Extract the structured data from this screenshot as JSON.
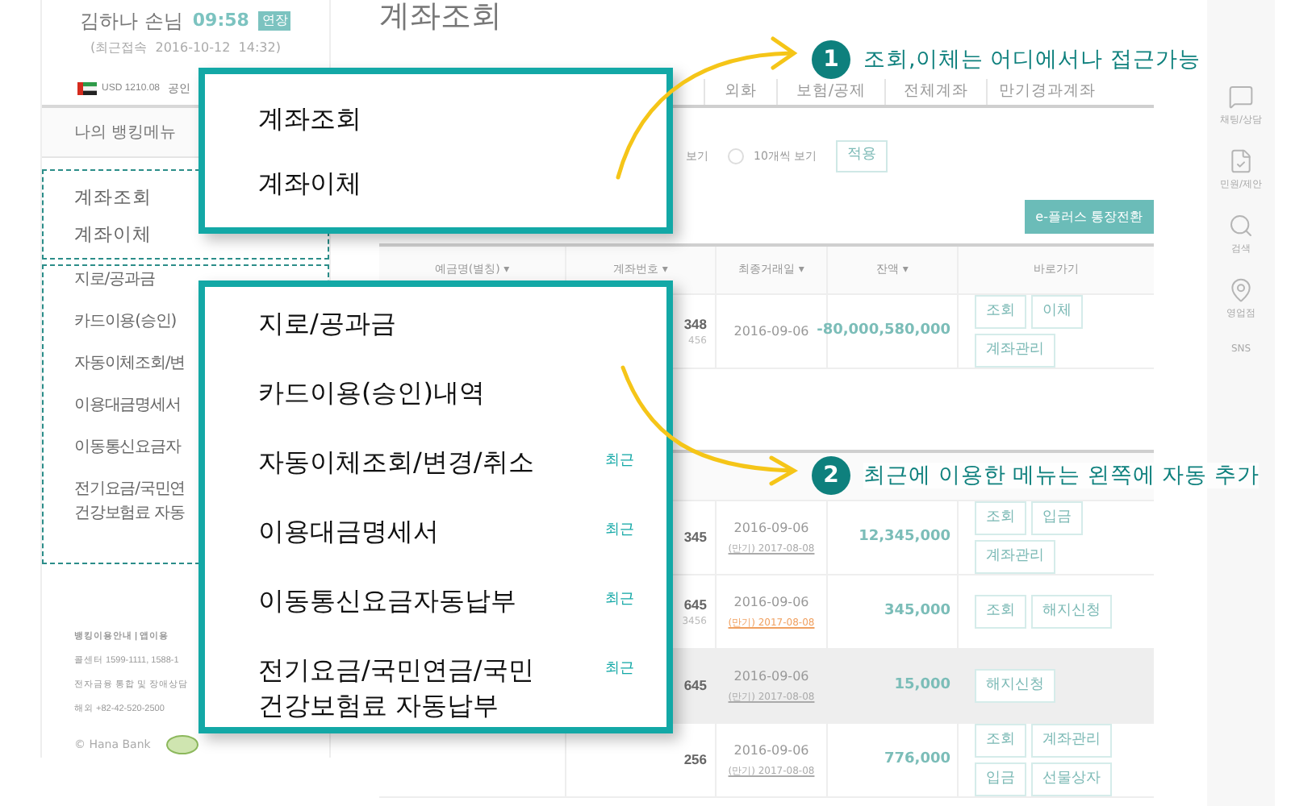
{
  "user": {
    "name": "김하나 손님",
    "time": "09:58",
    "extend": "연장",
    "last_login": "(최근접속  2016-10-12  14:32)",
    "currency": "USD 1210.08",
    "cert": "공인"
  },
  "sidebar": {
    "title": "나의 뱅킹메뉴",
    "pinned": [
      "계좌조회",
      "계좌이체"
    ],
    "recent": [
      {
        "lines": [
          "지로/공과금"
        ]
      },
      {
        "lines": [
          "카드이용(승인)"
        ]
      },
      {
        "lines": [
          "자동이체조회/변"
        ]
      },
      {
        "lines": [
          "이용대금명세서"
        ]
      },
      {
        "lines": [
          "이동통신요금자"
        ]
      },
      {
        "lines": [
          "전기요금/국민연",
          "건강보험료 자동"
        ]
      }
    ],
    "footer": [
      "뱅킹이용안내 | 앱이용",
      "콜센터 1599-1111, 1588-1",
      "전자금융 통합 및 장애상담",
      "해외 +82-42-520-2500"
    ],
    "copyright": "© Hana Bank"
  },
  "page_title": "계좌조회",
  "tabs": [
    {
      "label": "외화",
      "selected": false
    },
    {
      "label": "보험/공제",
      "selected": false
    },
    {
      "label": "전체계좌",
      "selected": false
    },
    {
      "label": "만기경과계좌",
      "selected": false
    }
  ],
  "view_options": {
    "partial": "보기",
    "radio": {
      "label": "10개씩 보기",
      "selected": false
    },
    "apply": "적용"
  },
  "convert_button": "e-플러스 통장전환",
  "table1": {
    "columns": [
      "예금명(별칭) ▾",
      "계좌번호 ▾",
      "최종거래일 ▾",
      "잔액 ▾",
      "바로가기"
    ],
    "rows": [
      {
        "account": "348",
        "sub": "456",
        "date": "2016-09-06",
        "balance": "-80,000,580,000",
        "actions": [
          "조회",
          "이체",
          "계좌관리"
        ]
      }
    ]
  },
  "table2": {
    "rows": [
      {
        "account": "345",
        "date": "2016-09-06",
        "maturity": "(만기) 2017-08-08",
        "alert": false,
        "shaded": false,
        "balance": "12,345,000",
        "actions": [
          "조회",
          "입금",
          "계좌관리"
        ]
      },
      {
        "account": "645",
        "sub": "3456",
        "date": "2016-09-06",
        "maturity": "(만기) 2017-08-08",
        "alert": true,
        "shaded": false,
        "balance": "345,000",
        "actions": [
          "조회",
          "해지신청"
        ]
      },
      {
        "account": "645",
        "date": "2016-09-06",
        "maturity": "(만기) 2017-08-08",
        "alert": false,
        "shaded": true,
        "balance": "15,000",
        "actions": [
          "해지신청"
        ]
      },
      {
        "account": "256",
        "date": "2016-09-06",
        "maturity": "(만기) 2017-08-08",
        "alert": false,
        "shaded": false,
        "balance": "776,000",
        "actions": [
          "조회",
          "계좌관리",
          "입금",
          "선물상자"
        ]
      }
    ]
  },
  "rail": [
    {
      "kind": "chat",
      "label": "채팅/상담"
    },
    {
      "kind": "document",
      "label": "민원/제안"
    },
    {
      "kind": "search",
      "label": "검색"
    },
    {
      "kind": "pin",
      "label": "영업점"
    },
    {
      "kind": "text",
      "label": "SNS"
    }
  ],
  "callouts": [
    {
      "number": "1",
      "text": "조회,이체는 어디에서나 접근가능"
    },
    {
      "number": "2",
      "text": "최근에 이용한 메뉴는 왼쪽에 자동 추가"
    }
  ],
  "panel1": {
    "items": [
      {
        "label": "계좌조회"
      },
      {
        "label": "계좌이체"
      }
    ]
  },
  "panel2": {
    "items": [
      {
        "lines": [
          "지로/공과금"
        ]
      },
      {
        "lines": [
          "카드이용(승인)내역"
        ]
      },
      {
        "lines": [
          "자동이체조회/변경/취소"
        ],
        "badge": "최근"
      },
      {
        "lines": [
          "이용대금명세서"
        ],
        "badge": "최근"
      },
      {
        "lines": [
          "이동통신요금자동납부"
        ],
        "badge": "최근"
      },
      {
        "lines": [
          "전기요금/국민연금/국민",
          "건강보험료 자동납부"
        ],
        "badge": "최근"
      }
    ]
  }
}
